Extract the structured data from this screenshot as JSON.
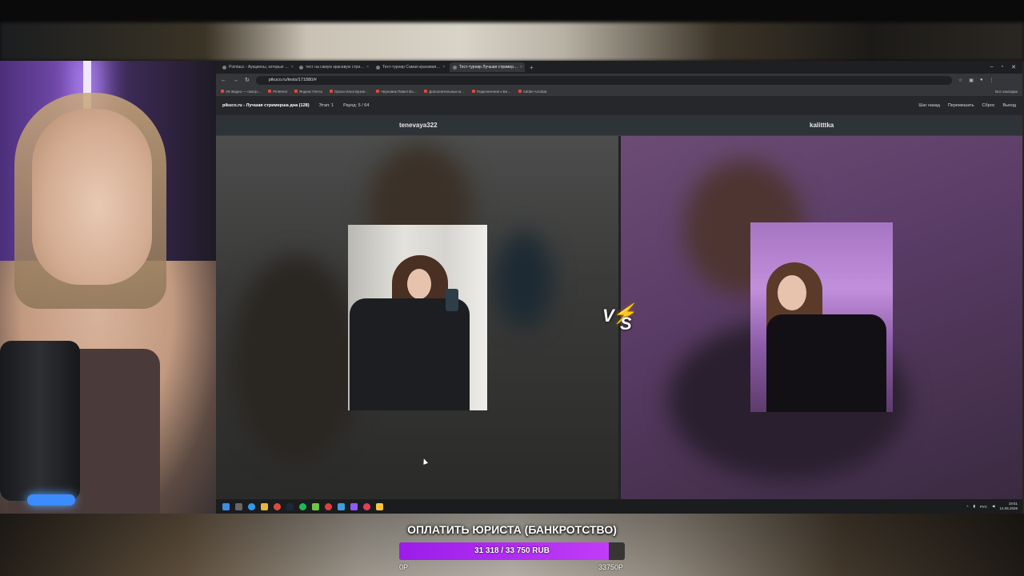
{
  "browser": {
    "tabs": [
      {
        "label": "Pointauc - Аукционы, которые …"
      },
      {
        "label": "тест на самую красивую стри…"
      },
      {
        "label": "Тест-турнир Самая красивая…"
      },
      {
        "label": "Тест-турнир Лучшая стример…"
      }
    ],
    "url": "pikuco.ru/tests/171880/#",
    "bookmarks": [
      {
        "label": "VK Видео — смотр…"
      },
      {
        "label": "Pinterest"
      },
      {
        "label": "Яндекс Почта"
      },
      {
        "label": "Орхон Илья Бузин…"
      },
      {
        "label": "Черновик Павел Во…"
      },
      {
        "label": "Дополнительные м…"
      },
      {
        "label": "Подключение к Бе…"
      },
      {
        "label": "Adobe Acrobat"
      }
    ],
    "bookmarks_right": "Все закладки"
  },
  "site": {
    "title": "pikuco.ru - Лучшая стримерша дна (128)",
    "stage": "Этап: 1",
    "round": "Раунд: 5 / 64",
    "actions": {
      "back": "Шаг назад",
      "shuffle": "Перемешать",
      "reset": "Сброс",
      "exit": "Выход"
    }
  },
  "match": {
    "left_name": "tenevaya322",
    "right_name": "kalitttka",
    "vs_text": "VS"
  },
  "taskbar": {
    "tray_lang": "РУС",
    "time": "19:51",
    "date": "14.05.2026"
  },
  "goal": {
    "title": "ОПЛАТИТЬ ЮРИСТА (БАНКРОТСТВО)",
    "progress_text": "31 318 / 33 750 RUB",
    "current": 31318,
    "target": 33750,
    "fraction": 0.928,
    "min_label": "0Р",
    "max_label": "33750Р"
  },
  "colors": {
    "progress_fill": "#b02df0",
    "vs_bolt": "#f4c430"
  }
}
